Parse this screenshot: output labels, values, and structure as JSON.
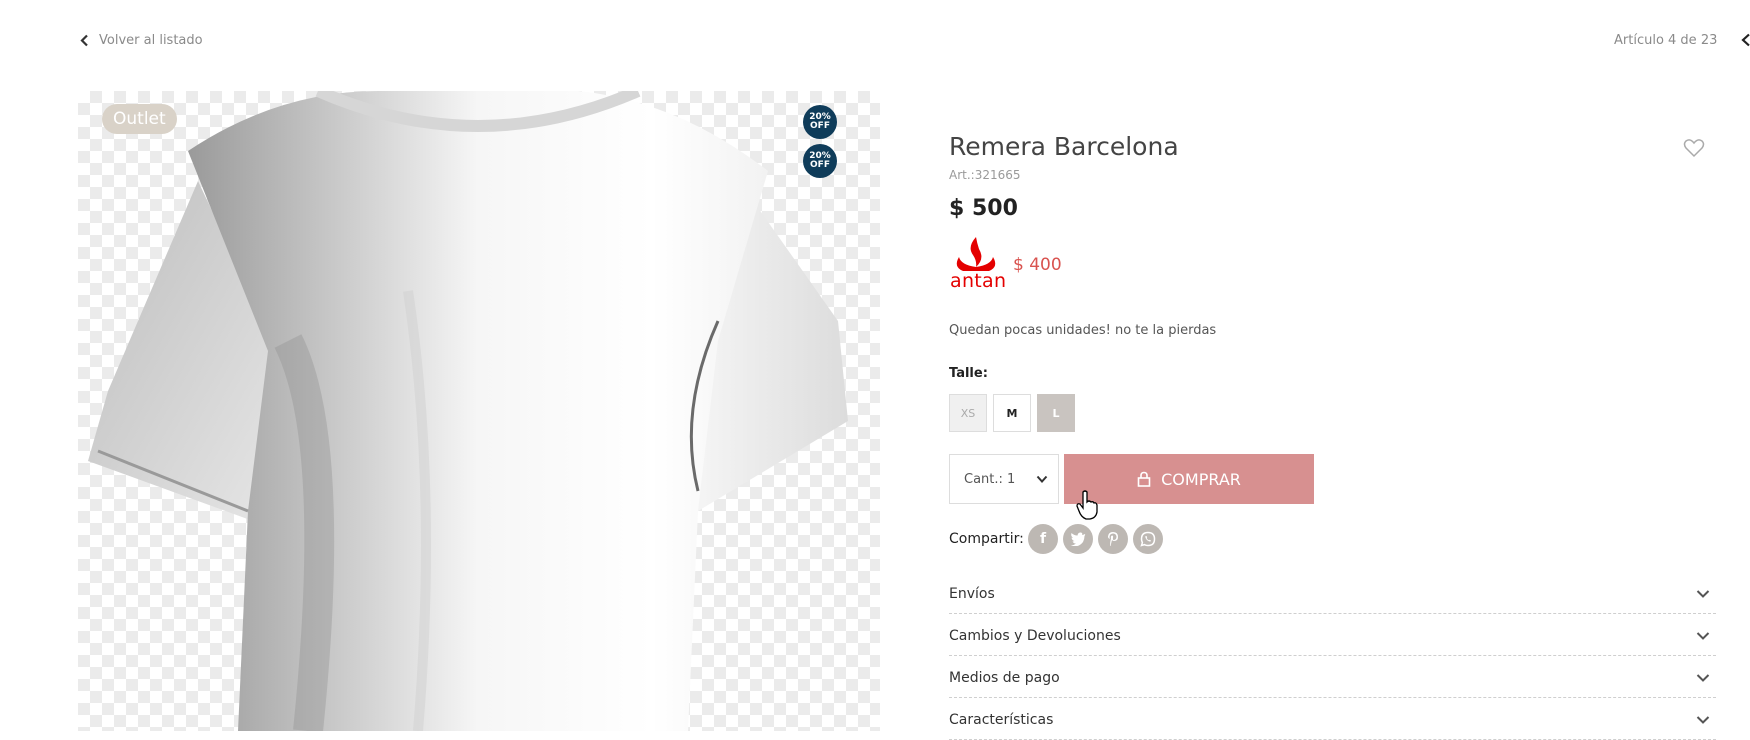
{
  "nav": {
    "back_label": "Volver al listado",
    "article_count": "Artículo 4 de 23"
  },
  "gallery": {
    "outlet_badge": "Outlet",
    "discount_badges": [
      {
        "line1": "20%",
        "line2": "OFF"
      },
      {
        "line1": "20%",
        "line2": "OFF"
      }
    ]
  },
  "product": {
    "title": "Remera Barcelona",
    "sku": "Art.:321665",
    "price": "$ 500",
    "bank_promo": {
      "bank_logo_text": "antan",
      "price": "$ 400",
      "logo_color": "#e40000"
    },
    "stock_message": "Quedan pocas unidades! no te la pierdas",
    "size_label": "Talle:",
    "sizes": [
      {
        "label": "XS",
        "state": "unavailable"
      },
      {
        "label": "M",
        "state": "available"
      },
      {
        "label": "L",
        "state": "selected"
      }
    ],
    "quantity_label": "Cant.: 1",
    "buy_label": "COMPRAR",
    "share_label": "Compartir:",
    "share_icons": [
      "facebook-icon",
      "twitter-icon",
      "pinterest-icon",
      "whatsapp-icon"
    ],
    "accordion": [
      {
        "label": "Envíos"
      },
      {
        "label": "Cambios y Devoluciones"
      },
      {
        "label": "Medios de pago"
      },
      {
        "label": "Características"
      }
    ]
  },
  "colors": {
    "buy_button": "#d79090",
    "promo_price": "#d9534f",
    "badge_off": "#0f3c5a",
    "badge_outlet": "#d9d2c8"
  }
}
